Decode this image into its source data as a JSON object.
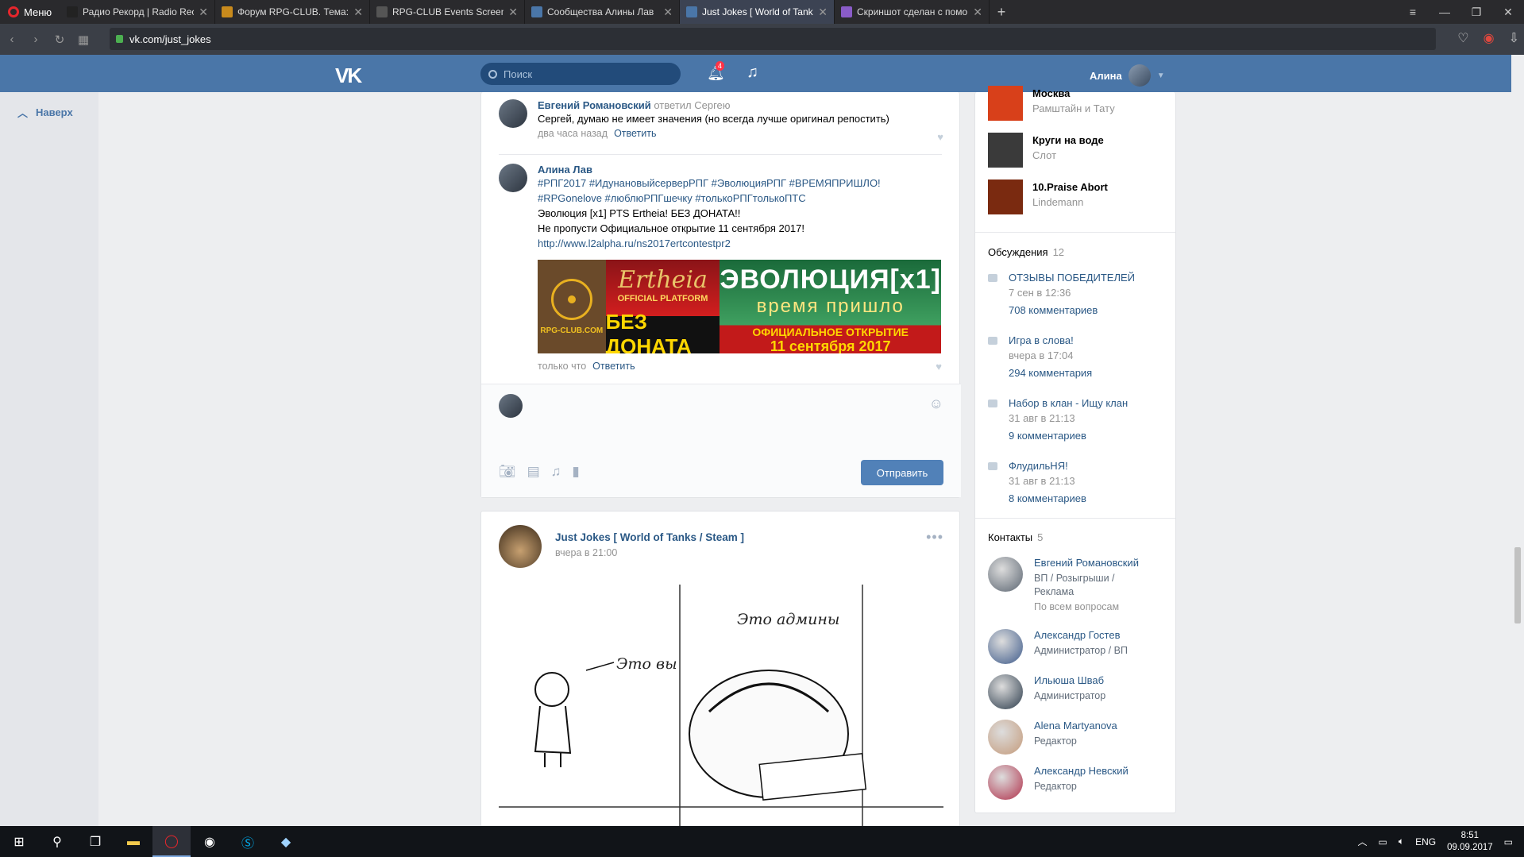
{
  "browser": {
    "menu_label": "Меню",
    "tabs": [
      {
        "title": "Радио Рекорд | Radio Rec",
        "color": "#222"
      },
      {
        "title": "Форум RPG-CLUB. Тема: R",
        "color": "#c88a1c"
      },
      {
        "title": "RPG-CLUB Events Screensh",
        "color": "#555"
      },
      {
        "title": "Сообщества Алины Лав",
        "color": "#4a76a8"
      },
      {
        "title": "Just Jokes [ World of Tanks",
        "color": "#4a76a8",
        "active": true
      },
      {
        "title": "Скриншот сделан с помо",
        "color": "#8a5cc8"
      }
    ],
    "url": "vk.com/just_jokes"
  },
  "header": {
    "search_placeholder": "Поиск",
    "notif_count": "4",
    "user_name": "Алина"
  },
  "left": {
    "to_top": "Наверх"
  },
  "comments": [
    {
      "author": "Евгений Романовский",
      "reply_to": "ответил Сергею",
      "text": "Сергей, думаю не имеет значения (но всегда лучше оригинал репостить)",
      "time": "два часа назад",
      "reply_label": "Ответить"
    },
    {
      "author": "Алина Лав",
      "lines": [
        "#РПГ2017 #ИдунановыйсерверРПГ #ЭволюцияРПГ #ВРЕМЯПРИШЛО!",
        "#RPGonelove #люблюРПГшечку #толькоРПГтолькоПТС",
        "Эволюция [x1] PTS Ertheia! БЕЗ ДОНАТА!!",
        "Не пропусти Официальное открытие 11 сентября 2017!"
      ],
      "link": "http://www.l2alpha.ru/ns2017ertcontestpr2",
      "time": "только что",
      "reply_label": "Ответить"
    }
  ],
  "banner": {
    "site": "RPG-CLUB.COM",
    "ertheia": "Ertheia",
    "official": "OFFICIAL PLATFORM",
    "no_donate": "БЕЗ ДОНАТА",
    "evolution": "ЭВОЛЮЦИЯ[x1]",
    "time_came": "время пришло",
    "opening": "ОФИЦИАЛЬНОЕ ОТКРЫТИЕ",
    "date": "11 сентября 2017"
  },
  "reply": {
    "send_label": "Отправить"
  },
  "post": {
    "author": "Just Jokes [ World of Tanks / Steam ]",
    "time": "вчера в 21:00",
    "comic_you": "Это вы",
    "comic_admins": "Это админы"
  },
  "right": {
    "tracks": [
      {
        "title": "Москва",
        "artist": "Рамштайн и Тату",
        "color": "#d8401a"
      },
      {
        "title": "Круги на воде",
        "artist": "Слот",
        "color": "#3a3a3a"
      },
      {
        "title": "10.Praise Abort",
        "artist": "Lindemann",
        "color": "#7a2a10"
      }
    ],
    "discussions_label": "Обсуждения",
    "discussions_count": "12",
    "discussions": [
      {
        "title": "ОТЗЫВЫ ПОБЕДИТЕЛЕЙ",
        "date": "7 сен в 12:36",
        "comments": "708 комментариев"
      },
      {
        "title": "Игра в слова!",
        "date": "вчера в 17:04",
        "comments": "294 комментария"
      },
      {
        "title": "Набор в клан - Ищу клан",
        "date": "31 авг в 21:13",
        "comments": "9 комментариев"
      },
      {
        "title": "ФлудильНЯ!",
        "date": "31 авг в 21:13",
        "comments": "8 комментариев"
      }
    ],
    "contacts_label": "Контакты",
    "contacts_count": "5",
    "contacts": [
      {
        "name": "Евгений Романовский",
        "role": "ВП / Розыгрыши / Реклама",
        "note": "По всем вопросам",
        "color": "#5a6470"
      },
      {
        "name": "Александр Гостев",
        "role": "Администратор / ВП",
        "color": "#3d5a8a"
      },
      {
        "name": "Ильюша Шваб",
        "role": "Администратор",
        "color": "#2a3a4a"
      },
      {
        "name": "Alena Martyanova",
        "role": "Редактор",
        "color": "#c49a7a"
      },
      {
        "name": "Александр Невский",
        "role": "Редактор",
        "color": "#b0304a"
      }
    ]
  },
  "taskbar": {
    "lang": "ENG",
    "time": "8:51",
    "date": "09.09.2017"
  }
}
